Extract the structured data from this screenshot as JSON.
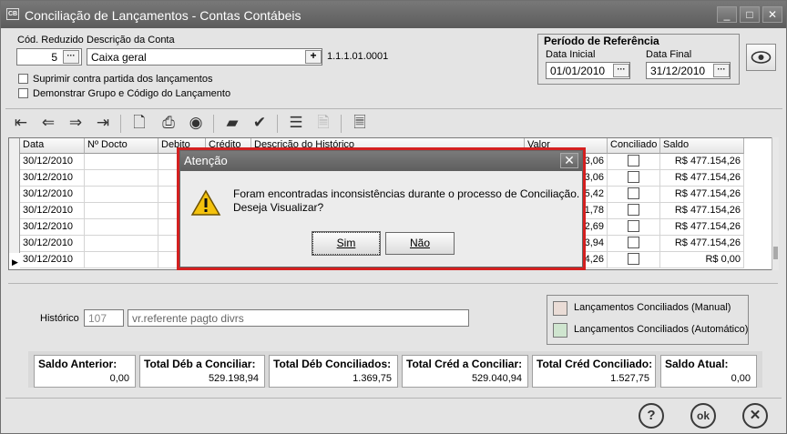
{
  "window": {
    "title": "Conciliação de Lançamentos - Contas Contábeis",
    "icon": "CB",
    "minimize": "_",
    "maximize": "□",
    "close": "✕"
  },
  "account": {
    "cod_label": "Cód. Reduzido",
    "cod_value": "5",
    "desc_label": "Descrição da Conta",
    "desc_value": "Caixa geral",
    "account_number": "1.1.1.01.0001"
  },
  "options": {
    "suppress_label": "Suprimir contra partida dos lançamentos",
    "group_label": "Demonstrar Grupo e Código do Lançamento"
  },
  "period": {
    "title": "Período de Referência",
    "start_label": "Data Inicial",
    "start_value": "01/01/2010",
    "end_label": "Data Final",
    "end_value": "31/12/2010"
  },
  "grid": {
    "headers": {
      "data": "Data",
      "docto": "Nº Docto",
      "debito": "Debito",
      "credito": "Crédito",
      "historico": "Descrição do Histórico",
      "valor": "Valor",
      "conciliado": "Conciliado",
      "saldo": "Saldo"
    },
    "rows": [
      {
        "date": "30/12/2010",
        "valor": "3,06",
        "saldo": "R$ 477.154,26"
      },
      {
        "date": "30/12/2010",
        "valor": "3,06",
        "saldo": "R$ 477.154,26"
      },
      {
        "date": "30/12/2010",
        "valor": "5,42",
        "saldo": "R$ 477.154,26"
      },
      {
        "date": "30/12/2010",
        "valor": "1,78",
        "saldo": "R$ 477.154,26"
      },
      {
        "date": "30/12/2010",
        "valor": "2,69",
        "saldo": "R$ 477.154,26"
      },
      {
        "date": "30/12/2010",
        "valor": "3,94",
        "saldo": "R$ 477.154,26"
      },
      {
        "date": "30/12/2010",
        "valor": "4,26",
        "saldo": "R$ 0,00"
      }
    ]
  },
  "historico": {
    "label": "Histórico",
    "code": "107",
    "text": "vr.referente pagto divrs"
  },
  "legend": {
    "manual_label": "Lançamentos Conciliados (Manual)",
    "manual_color": "#eadcd6",
    "auto_label": "Lançamentos Conciliados (Automático)",
    "auto_color": "#cfe5cf"
  },
  "totals": [
    {
      "label": "Saldo Anterior:",
      "value": "0,00"
    },
    {
      "label": "Total Déb a Conciliar:",
      "value": "529.198,94"
    },
    {
      "label": "Total Déb Conciliados:",
      "value": "1.369,75"
    },
    {
      "label": "Total Créd a Conciliar:",
      "value": "529.040,94"
    },
    {
      "label": "Total Créd Conciliado:",
      "value": "1.527,75"
    },
    {
      "label": "Saldo Atual:",
      "value": "0,00"
    }
  ],
  "footer": {
    "help": "?",
    "ok": "ok",
    "cancel": "✕"
  },
  "dialog": {
    "title": "Atenção",
    "close": "✕",
    "line1": "Foram encontradas inconsistências durante o processo de Conciliação.",
    "line2": "Deseja Visualizar?",
    "yes": "Sim",
    "no": "Não"
  }
}
